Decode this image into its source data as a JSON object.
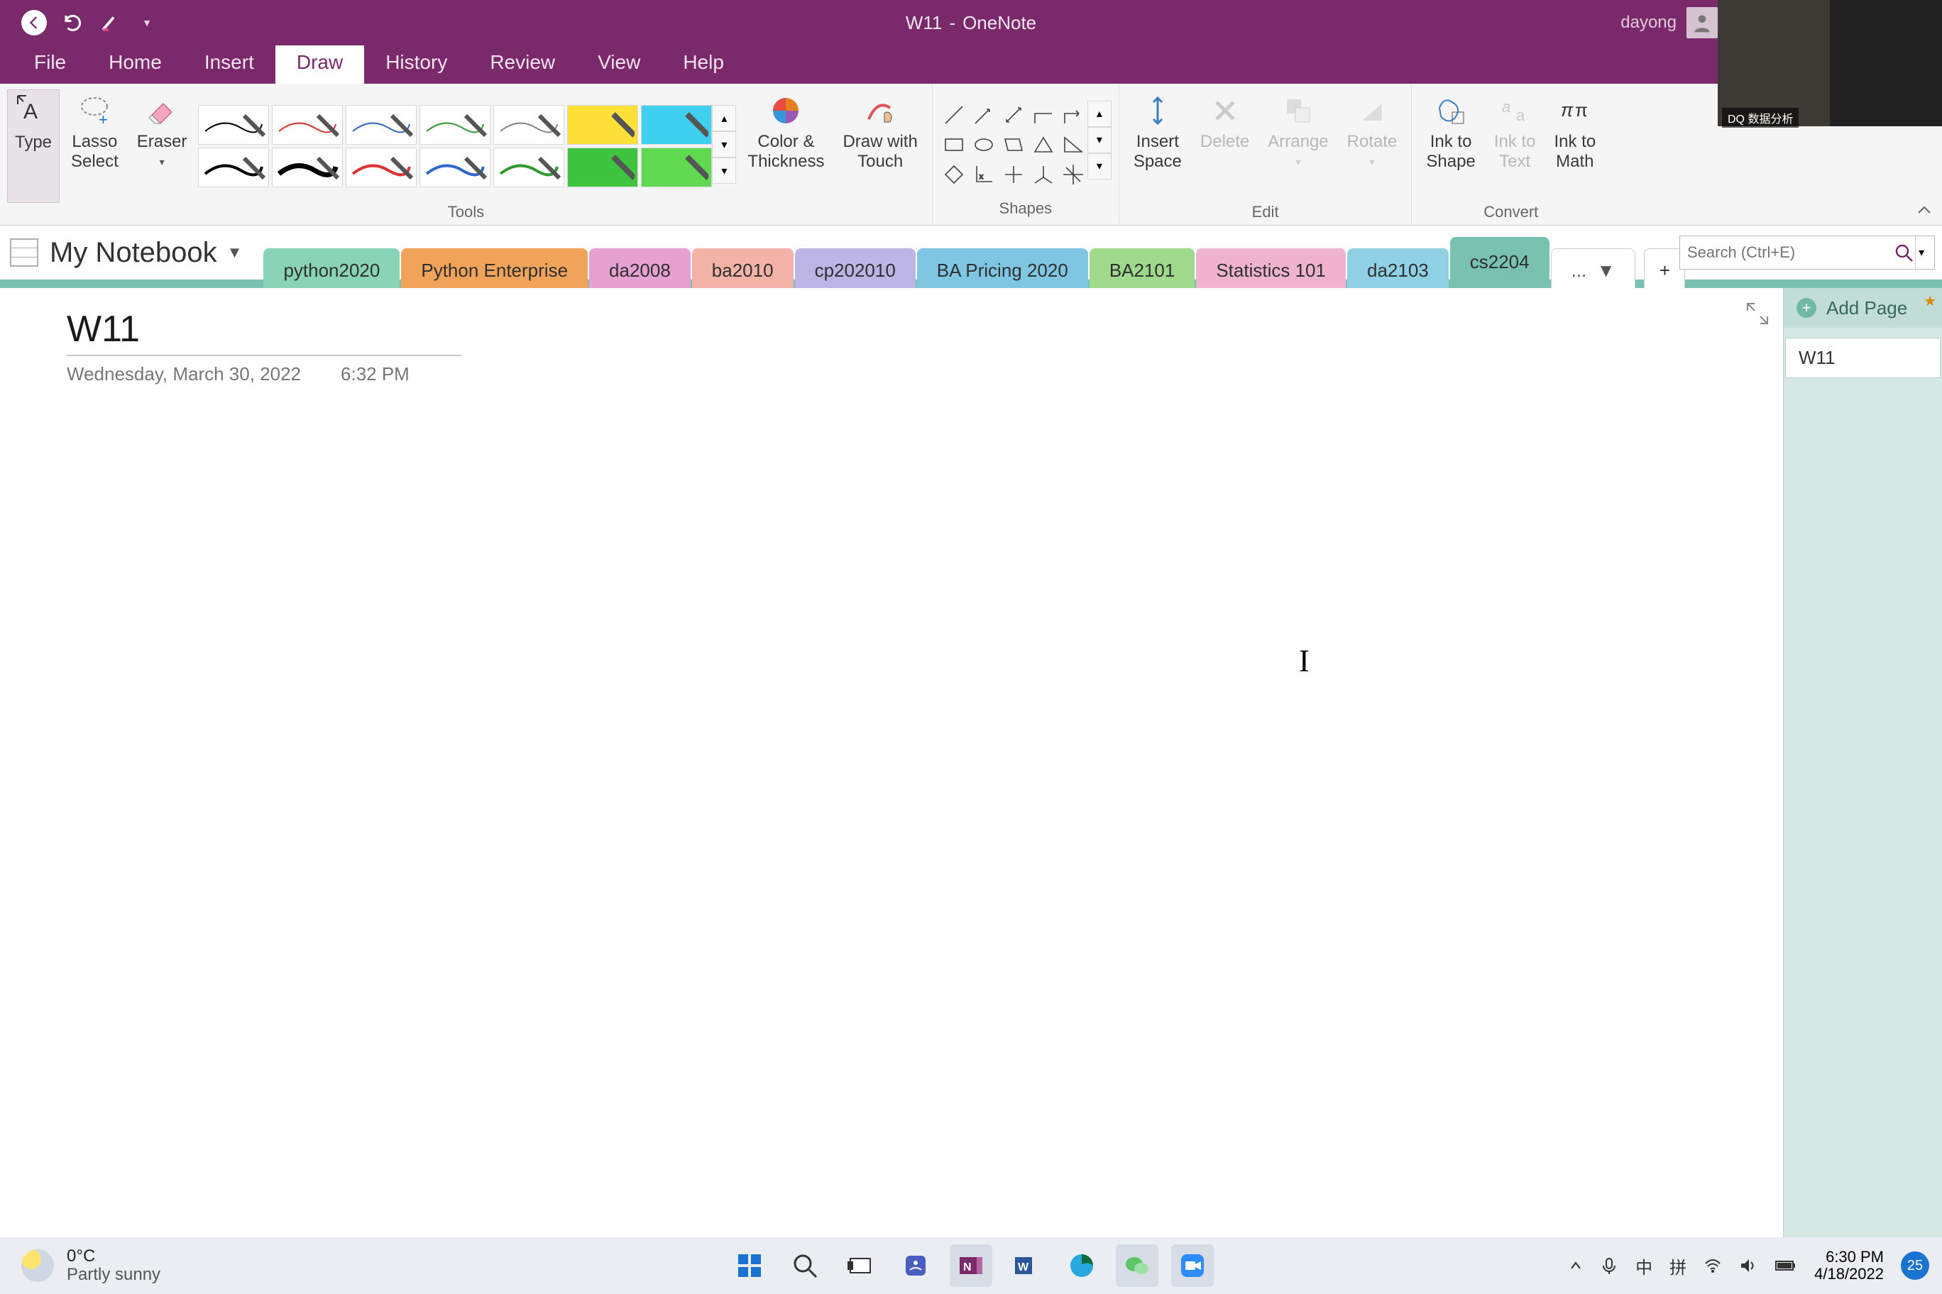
{
  "window": {
    "doc_title": "W11",
    "app_name": "OneNote",
    "separator": "  -  "
  },
  "user": {
    "name": "dayong"
  },
  "camera": {
    "label": "DQ 数据分析"
  },
  "ribbon_tabs": {
    "items": [
      {
        "label": "File"
      },
      {
        "label": "Home"
      },
      {
        "label": "Insert"
      },
      {
        "label": "Draw"
      },
      {
        "label": "History"
      },
      {
        "label": "Review"
      },
      {
        "label": "View"
      },
      {
        "label": "Help"
      }
    ],
    "active_index": 3
  },
  "ribbon": {
    "tools": {
      "type": "Type",
      "lasso": "Lasso\nSelect",
      "eraser": "Eraser",
      "color_thickness": "Color &\nThickness",
      "draw_touch": "Draw with\nTouch",
      "group_label": "Tools"
    },
    "shapes": {
      "group_label": "Shapes"
    },
    "edit": {
      "insert_space": "Insert\nSpace",
      "delete": "Delete",
      "arrange": "Arrange",
      "rotate": "Rotate",
      "group_label": "Edit"
    },
    "convert": {
      "ink_shape": "Ink to\nShape",
      "ink_text": "Ink to\nText",
      "ink_math": "Ink to\nMath",
      "group_label": "Convert"
    }
  },
  "notebook": {
    "name": "My Notebook",
    "sections": [
      {
        "label": "python2020",
        "color": "#89d4b6"
      },
      {
        "label": "Python Enterprise",
        "color": "#f2a35a"
      },
      {
        "label": "da2008",
        "color": "#e6a1d0"
      },
      {
        "label": "ba2010",
        "color": "#f3b3a7"
      },
      {
        "label": "cp202010",
        "color": "#bdb4e6"
      },
      {
        "label": "BA Pricing 2020",
        "color": "#7fc6e3"
      },
      {
        "label": "BA2101",
        "color": "#9fd98b"
      },
      {
        "label": "Statistics 101",
        "color": "#f0b3ce"
      },
      {
        "label": "da2103",
        "color": "#8fd0e5"
      },
      {
        "label": "cs2204",
        "color": "#78c2af"
      }
    ],
    "active_section_index": 9,
    "more_label": "...",
    "add_label": "+"
  },
  "search": {
    "placeholder": "Search (Ctrl+E)"
  },
  "page": {
    "title": "W11",
    "date": "Wednesday, March 30, 2022",
    "time": "6:32 PM"
  },
  "page_panel": {
    "add_page": "Add Page",
    "pages": [
      {
        "label": "W11"
      }
    ]
  },
  "taskbar": {
    "weather": {
      "temp": "0°C",
      "desc": "Partly sunny"
    },
    "ime": "中",
    "ime2": "拼",
    "clock": {
      "time": "6:30 PM",
      "date": "4/18/2022"
    },
    "notif_count": "25"
  }
}
